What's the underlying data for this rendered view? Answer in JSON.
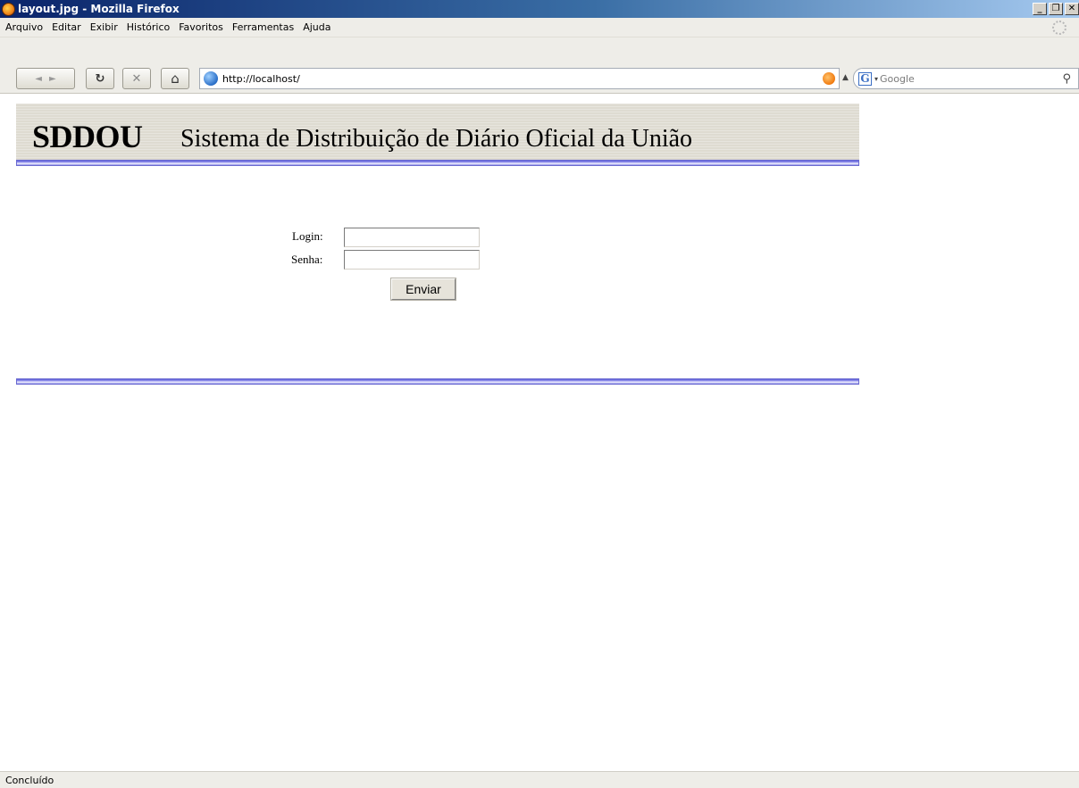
{
  "window": {
    "title": "layout.jpg - Mozilla Firefox",
    "buttons": {
      "minimize": "_",
      "maximize": "❐",
      "close": "✕"
    }
  },
  "menubar": {
    "items": [
      {
        "label": "Arquivo",
        "accesskey": "A"
      },
      {
        "label": "Editar",
        "accesskey": "E"
      },
      {
        "label": "Exibir",
        "accesskey": "x"
      },
      {
        "label": "Histórico",
        "accesskey": "H"
      },
      {
        "label": "Favoritos",
        "accesskey": "v"
      },
      {
        "label": "Ferramentas",
        "accesskey": "F"
      },
      {
        "label": "Ajuda",
        "accesskey": "u"
      }
    ]
  },
  "navbar": {
    "back_icon": "◄",
    "forward_icon": "►",
    "reload_icon": "↻",
    "stop_icon": "✕",
    "home_icon": "⌂",
    "url": "http://localhost/",
    "search_placeholder": "Google",
    "search_engine_icon": "G",
    "search_icon": "⚲"
  },
  "page": {
    "brand": "SDDOU",
    "tagline": "Sistema de Distribuição de Diário Oficial da União",
    "login_label": "Login:",
    "password_label": "Senha:",
    "login_value": "",
    "password_value": "",
    "submit_label": "Enviar"
  },
  "status": {
    "text": "Concluído"
  },
  "colors": {
    "titlebar_start": "#0a246a",
    "titlebar_end": "#a6caf0",
    "chrome": "#eeede8",
    "banner": "#dedbd1",
    "rule": "#6a6ad0"
  }
}
